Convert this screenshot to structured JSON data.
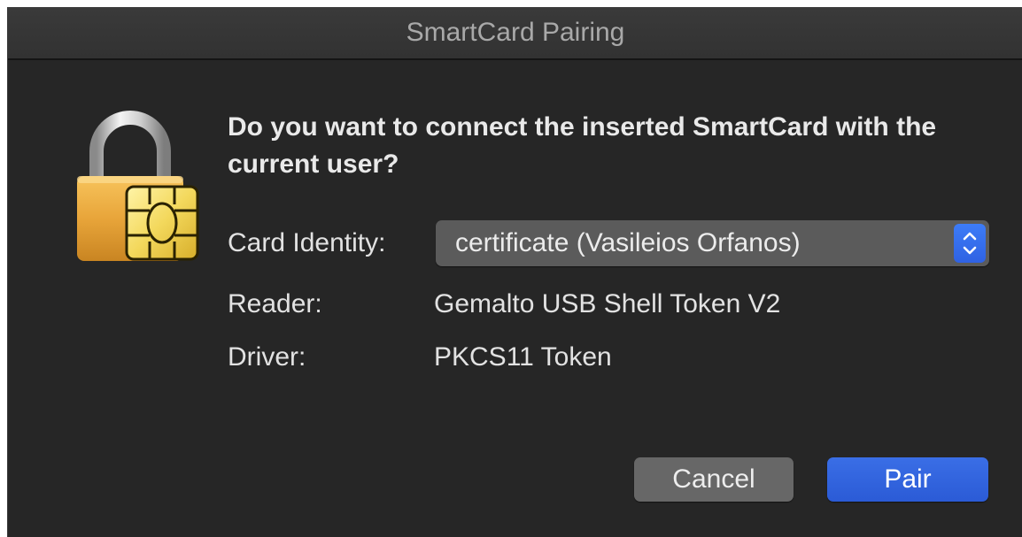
{
  "window": {
    "title": "SmartCard Pairing"
  },
  "dialog": {
    "question": "Do you want to connect the inserted SmartCard with the current user?",
    "icon": "lock-smartcard-icon",
    "card_identity": {
      "label": "Card Identity:",
      "selected_value": "certificate (Vasileios Orfanos)",
      "stepper_icon": "up-down-chevron-icon"
    },
    "reader": {
      "label": "Reader:",
      "value": "Gemalto USB Shell Token V2"
    },
    "driver": {
      "label": "Driver:",
      "value": "PKCS11 Token"
    }
  },
  "buttons": {
    "cancel_label": "Cancel",
    "pair_label": "Pair"
  },
  "colors": {
    "background": "#262626",
    "titlebar": "#363636",
    "accent": "#2f62e3",
    "cancel_button": "#676767",
    "text": "#e2e2e2"
  }
}
